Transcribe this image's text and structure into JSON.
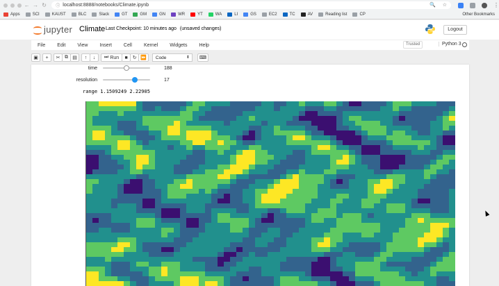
{
  "browser": {
    "url": "localhost:8888/notebooks/Climate.ipynb"
  },
  "bookmarks": {
    "items": [
      {
        "label": "Apps",
        "color": "#e94235"
      },
      {
        "label": "SCI",
        "color": "#9aa0a6"
      },
      {
        "label": "KAUST",
        "color": "#9aa0a6"
      },
      {
        "label": "BLC",
        "color": "#9aa0a6"
      },
      {
        "label": "Slack",
        "color": "#9aa0a6"
      },
      {
        "label": "GT",
        "color": "#4285f4"
      },
      {
        "label": "GM",
        "color": "#34a853"
      },
      {
        "label": "GN",
        "color": "#4285f4"
      },
      {
        "label": "WR",
        "color": "#6f42c1"
      },
      {
        "label": "YT",
        "color": "#ff0000"
      },
      {
        "label": "WA",
        "color": "#25d366"
      },
      {
        "label": "LI",
        "color": "#0a66c2"
      },
      {
        "label": "GS",
        "color": "#4285f4"
      },
      {
        "label": "EC2",
        "color": "#9aa0a6"
      },
      {
        "label": "TC",
        "color": "#0a66c2"
      },
      {
        "label": "AV",
        "color": "#222222"
      },
      {
        "label": "Reading list",
        "color": "#9aa0a6"
      },
      {
        "label": "CP",
        "color": "#9aa0a6"
      }
    ],
    "other": "Other Bookmarks"
  },
  "header": {
    "logo_text": "jupyter",
    "notebook_name": "Climate",
    "checkpoint": "Last Checkpoint: 10 minutes ago",
    "unsaved": "(unsaved changes)",
    "logout": "Logout"
  },
  "menu": {
    "items": [
      "File",
      "Edit",
      "View",
      "Insert",
      "Cell",
      "Kernel",
      "Widgets",
      "Help"
    ],
    "trusted": "Trusted",
    "kernel": "Python 3"
  },
  "toolbar": {
    "run": "Run",
    "cell_type": "Code"
  },
  "widgets": {
    "time": {
      "label": "time",
      "value": "188",
      "fraction": 0.5
    },
    "resolution": {
      "label": "resolution",
      "value": "17",
      "fraction": 0.7
    }
  },
  "output": {
    "range_text": "range 1.1509249 2.22905"
  },
  "colors": {
    "jupyter_orange": "#f37726",
    "slider_thumb": "#2196f3",
    "viridis": [
      "#3b0f70",
      "#33638d",
      "#21908d",
      "#5ec962",
      "#fde725"
    ]
  }
}
